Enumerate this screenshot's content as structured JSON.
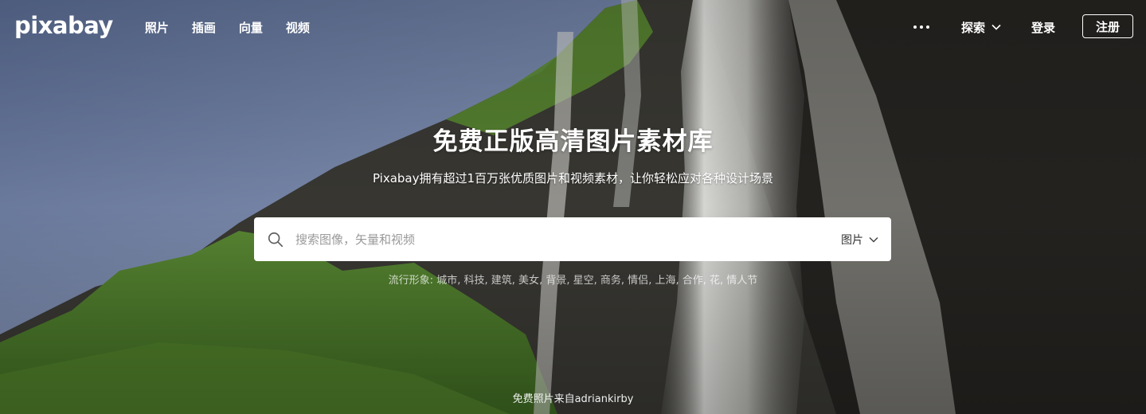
{
  "brand": {
    "logo": "pixabay"
  },
  "nav": {
    "items": [
      {
        "label": "照片"
      },
      {
        "label": "插画"
      },
      {
        "label": "向量"
      },
      {
        "label": "视频"
      }
    ]
  },
  "header_right": {
    "explore_label": "探索",
    "login_label": "登录",
    "signup_label": "注册"
  },
  "hero": {
    "title": "免费正版高清图片素材库",
    "subtitle": "Pixabay拥有超过1百万张优质图片和视频素材，让你轻松应对各种设计场景"
  },
  "search": {
    "placeholder": "搜索图像，矢量和视频",
    "value": "",
    "type_selected": "图片"
  },
  "trending": {
    "prefix": "流行形象:",
    "tags": [
      "城市",
      "科技",
      "建筑",
      "美女",
      "背景",
      "星空",
      "商务",
      "情侣",
      "上海",
      "合作",
      "花",
      "情人节"
    ]
  },
  "credit": {
    "prefix": "免费照片来自",
    "author": "adriankirby"
  },
  "colors": {
    "sky": "#7d8db0",
    "grass": "#4f7a2c",
    "rock": "#2f2d2a",
    "search_bg": "#ffffff",
    "text": "#ffffff"
  }
}
